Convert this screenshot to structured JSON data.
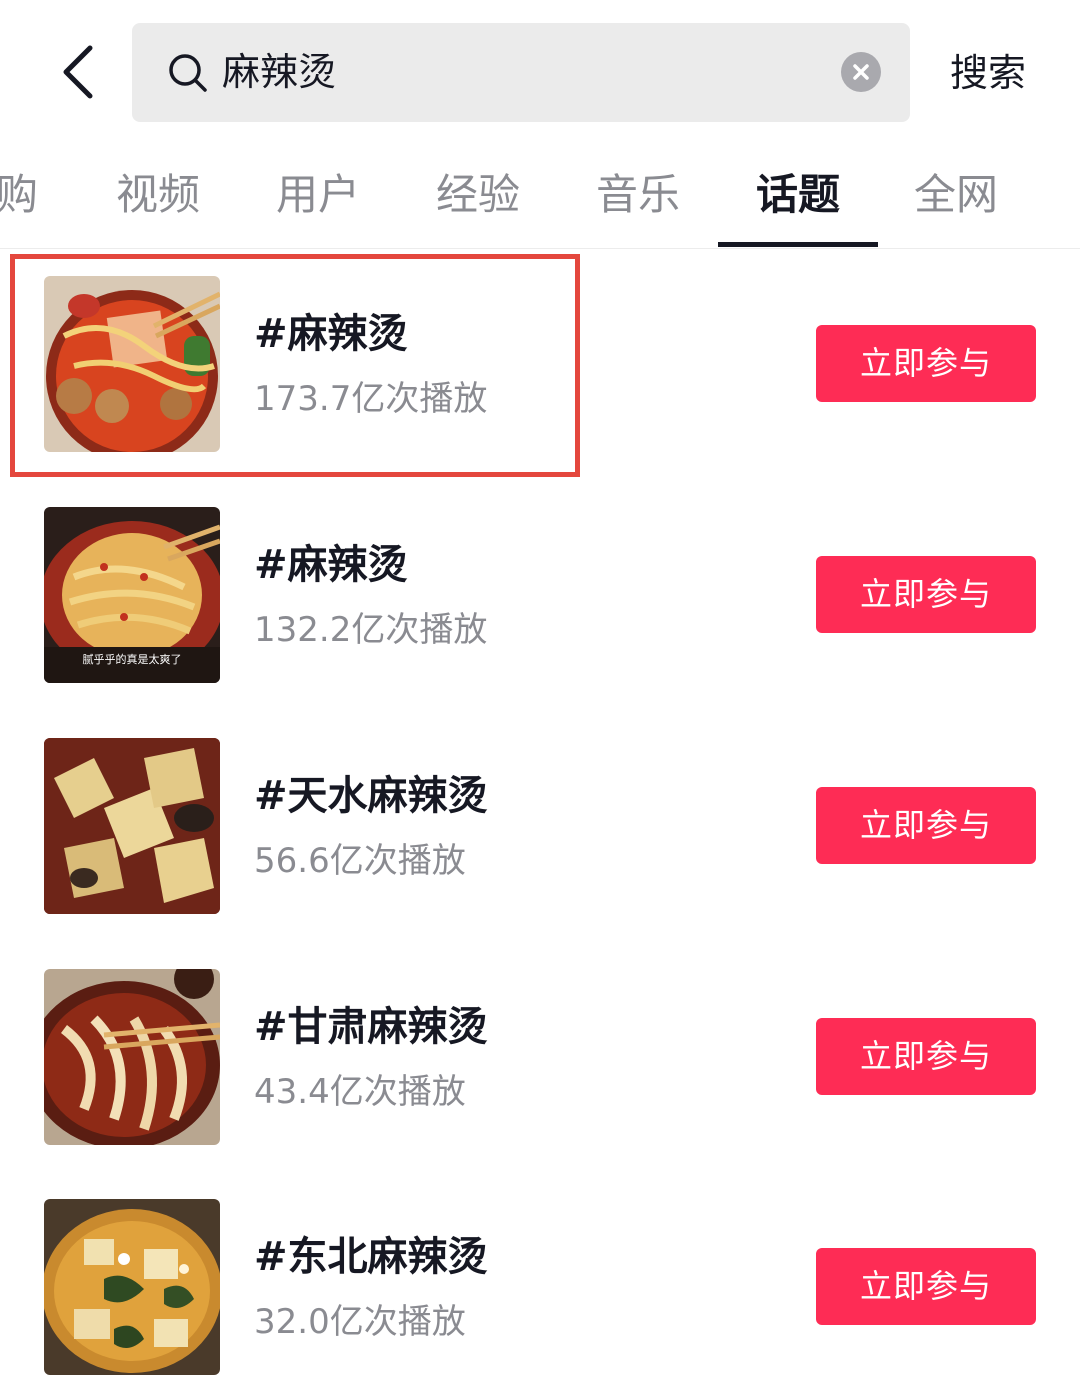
{
  "search": {
    "query": "麻辣烫",
    "submit_label": "搜索"
  },
  "tabs": [
    {
      "label": "购",
      "active": false
    },
    {
      "label": "视频",
      "active": false
    },
    {
      "label": "用户",
      "active": false
    },
    {
      "label": "经验",
      "active": false
    },
    {
      "label": "音乐",
      "active": false
    },
    {
      "label": "话题",
      "active": true
    },
    {
      "label": "全网",
      "active": false
    }
  ],
  "topics": [
    {
      "title": "#麻辣烫",
      "plays": "173.7亿次播放",
      "button": "立即参与",
      "thumb_caption": ""
    },
    {
      "title": "#麻辣烫",
      "plays": "132.2亿次播放",
      "button": "立即参与",
      "thumb_caption": "腻乎乎的真是太爽了"
    },
    {
      "title": "#天水麻辣烫",
      "plays": "56.6亿次播放",
      "button": "立即参与",
      "thumb_caption": ""
    },
    {
      "title": "#甘肃麻辣烫",
      "plays": "43.4亿次播放",
      "button": "立即参与",
      "thumb_caption": ""
    },
    {
      "title": "#东北麻辣烫",
      "plays": "32.0亿次播放",
      "button": "立即参与",
      "thumb_caption": ""
    }
  ],
  "colors": {
    "accent": "#fe2c55",
    "highlight": "#e4473d"
  },
  "icons": {
    "back": "chevron-left-icon",
    "search": "search-icon",
    "clear": "clear-icon"
  }
}
